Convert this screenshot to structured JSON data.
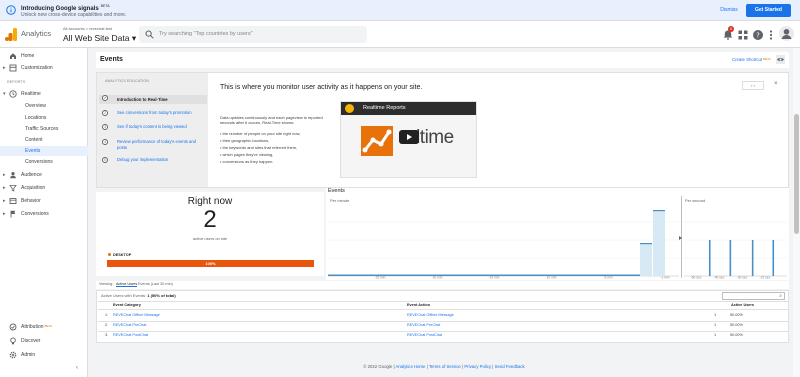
{
  "banner": {
    "title": "Introducing Google signals",
    "beta": "BETA",
    "subtitle": "Unlock new cross-device capabilities and more.",
    "dismiss": "Dismiss",
    "get_started": "Get Started"
  },
  "header": {
    "app_name": "Analytics",
    "account_line": "All accounts > revechat.test",
    "view_name": "All Web Site Data",
    "search_placeholder": "Try searching \"Top countries by users\"",
    "notification_count": "8"
  },
  "sidebar": {
    "home": "Home",
    "customization": "Customization",
    "reports_label": "REPORTS",
    "realtime": "Realtime",
    "realtime_items": [
      "Overview",
      "Locations",
      "Traffic Sources",
      "Content",
      "Events",
      "Conversions"
    ],
    "audience": "Audience",
    "acquisition": "Acquisition",
    "behavior": "Behavior",
    "conversions": "Conversions",
    "attribution": "Attribution",
    "attribution_beta": "BETA",
    "discover": "Discover",
    "admin": "Admin"
  },
  "page": {
    "title": "Events",
    "create_shortcut": "Create Shortcut",
    "create_shortcut_beta": "BETA"
  },
  "education": {
    "header": "ANALYTICS EDUCATION",
    "steps": [
      "Introduction to Real-Time",
      "See conversions from today's promotion",
      "See if today's content is being viewed",
      "Review performance of today's events and posts",
      "Debug your implementation"
    ],
    "heading": "This is where you monitor user activity as it happens on your site.",
    "paragraph": "Data updates continuously and each pageview is reported seconds after it occurs. Real-Time shows:",
    "bullets": [
      "the number of people on your site right now,",
      "their geographic locations,",
      "the keywords and sites that referred them,",
      "which pages they're viewing,",
      "conversions as they happen."
    ],
    "video_title": "Realtime Reports",
    "video_text": "altime"
  },
  "right_now": {
    "title": "Right now",
    "count": "2",
    "subtitle": "active users on site",
    "device": "DESKTOP",
    "percent_label": "100%",
    "percent": 100
  },
  "charts": {
    "title": "Events",
    "per_minute": "Per minute",
    "per_second": "Per second",
    "minute_ticks": [
      "-25 min",
      "-20 min",
      "-15 min",
      "-10 min",
      "-5 min",
      "-1 min"
    ],
    "second_ticks": [
      "-60 sec",
      "-45 sec",
      "-30 sec",
      "-15 sec"
    ]
  },
  "chart_data": [
    {
      "type": "bar",
      "title": "Per minute",
      "x": [
        -5,
        -4,
        -3,
        -2,
        -1
      ],
      "values": [
        0,
        0,
        0,
        0.5,
        1
      ],
      "note": "values shown relative to chart height; no y-axis labels printed"
    },
    {
      "type": "bar",
      "title": "Per second",
      "x": [
        -45,
        -33,
        -20,
        -8
      ],
      "values": [
        1,
        1,
        1,
        1
      ]
    }
  ],
  "table": {
    "tabs": [
      "Viewing:",
      "Active Users",
      "Events (Last 30 min)"
    ],
    "summary_label": "Active Users with Events:",
    "summary_value": "1 (50% of total)",
    "columns": [
      "Event Category",
      "Event Action",
      "Active Users"
    ],
    "rows": [
      {
        "idx": "1.",
        "category": "REVEChat Offline Message",
        "action": "REVEChat Offline Message",
        "users": "1",
        "pct": "50.00%"
      },
      {
        "idx": "2.",
        "category": "REVEChat PreChat",
        "action": "REVEChat PreChat",
        "users": "1",
        "pct": "50.00%"
      },
      {
        "idx": "3.",
        "category": "REVEChat PostChat",
        "action": "REVEChat PostChat",
        "users": "1",
        "pct": "50.00%"
      }
    ]
  },
  "footer": {
    "copyright": "© 2022 Google",
    "links": [
      "Analytics Home",
      "Terms of Service",
      "Privacy Policy",
      "Send Feedback"
    ]
  }
}
